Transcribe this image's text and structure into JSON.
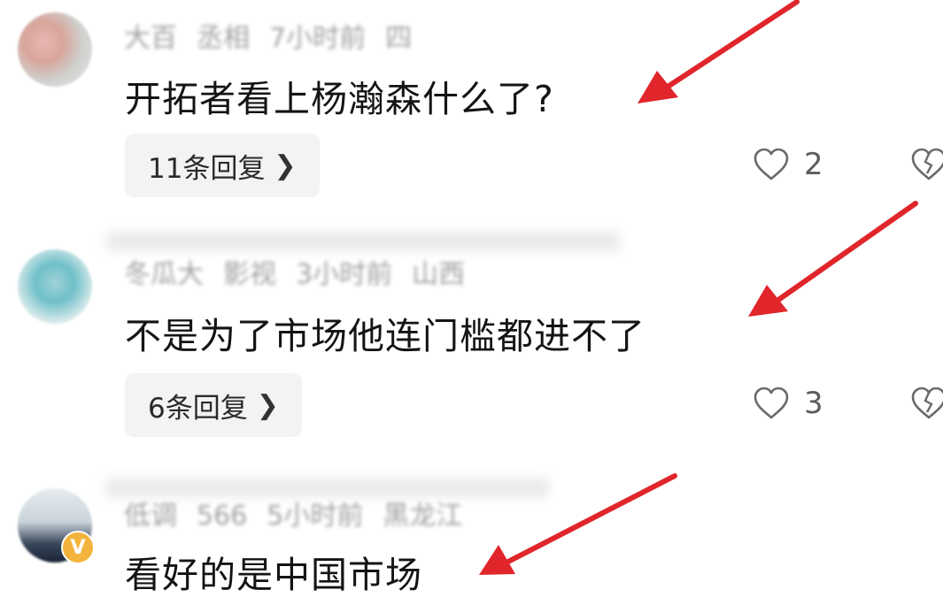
{
  "comments": [
    {
      "author": "大百",
      "author_extra": "丞相",
      "time": "7小时前",
      "location": "四",
      "text": "开拓者看上杨瀚森什么了?",
      "replies": "11条回复",
      "likes": "2"
    },
    {
      "author": "冬瓜大",
      "author_extra": "影视",
      "time": "3小时前",
      "location": "山西",
      "text": "不是为了市场他连门槛都进不了",
      "replies": "6条回复",
      "likes": "3"
    },
    {
      "author": "低调",
      "author_extra": "566",
      "time": "5小时前",
      "location": "黑龙江",
      "text": "看好的是中国市场",
      "badge": "V"
    }
  ],
  "icons": {
    "reply_chevron": "chevron-right-icon",
    "like": "heart-outline-icon",
    "dislike": "broken-heart-icon"
  },
  "colors": {
    "arrow": "#e0262b",
    "badge": "#f4b33c"
  }
}
